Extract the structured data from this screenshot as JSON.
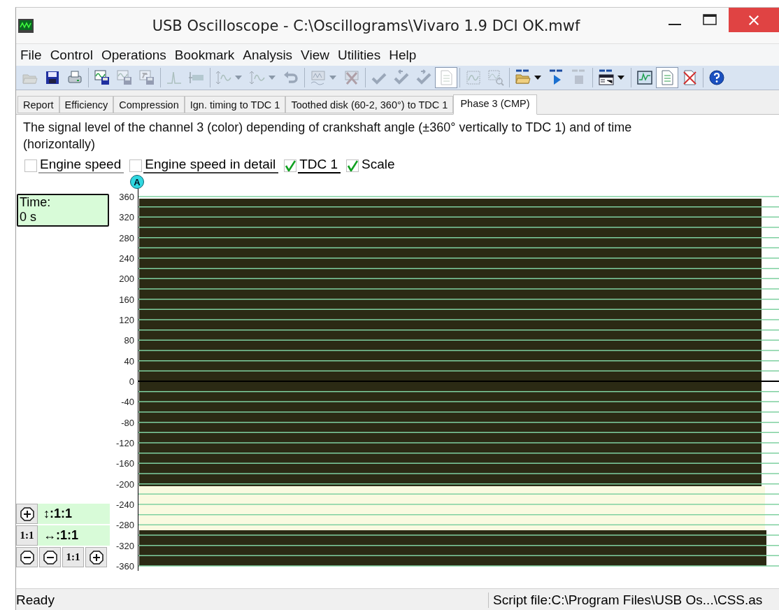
{
  "window": {
    "title": "USB Oscilloscope - C:\\Oscillograms\\Vivaro 1.9 DCI OK.mwf"
  },
  "menu": [
    "File",
    "Control",
    "Operations",
    "Bookmark",
    "Analysis",
    "View",
    "Utilities",
    "Help"
  ],
  "toolbar": [
    {
      "kind": "open",
      "disabled": true,
      "pressed": false,
      "dropdown": false
    },
    {
      "kind": "save",
      "disabled": false,
      "pressed": false,
      "dropdown": false
    },
    {
      "kind": "print",
      "disabled": false,
      "pressed": false,
      "dropdown": false
    },
    {
      "kind": "separator"
    },
    {
      "kind": "chart-save",
      "disabled": false,
      "pressed": false,
      "dropdown": false
    },
    {
      "kind": "chart-save",
      "disabled": true,
      "pressed": false,
      "dropdown": false
    },
    {
      "kind": "hammer-save",
      "disabled": true,
      "pressed": false,
      "dropdown": false
    },
    {
      "kind": "separator"
    },
    {
      "kind": "peak",
      "disabled": true,
      "pressed": false,
      "dropdown": false
    },
    {
      "kind": "measure",
      "disabled": true,
      "pressed": false,
      "dropdown": false
    },
    {
      "kind": "separator"
    },
    {
      "kind": "scale-wave",
      "disabled": true,
      "pressed": false,
      "dropdown": true
    },
    {
      "kind": "scale-wave",
      "disabled": true,
      "pressed": false,
      "dropdown": true
    },
    {
      "kind": "undo",
      "disabled": true,
      "pressed": false,
      "dropdown": false
    },
    {
      "kind": "separator"
    },
    {
      "kind": "monitor-wave",
      "disabled": true,
      "pressed": false,
      "dropdown": true
    },
    {
      "kind": "delete-wave",
      "disabled": true,
      "pressed": false,
      "dropdown": false
    },
    {
      "kind": "separator"
    },
    {
      "kind": "check",
      "disabled": true,
      "pressed": false,
      "dropdown": false
    },
    {
      "kind": "check-left",
      "disabled": true,
      "pressed": false,
      "dropdown": false
    },
    {
      "kind": "check-right",
      "disabled": true,
      "pressed": false,
      "dropdown": false
    },
    {
      "kind": "document",
      "disabled": true,
      "pressed": true,
      "dropdown": false
    },
    {
      "kind": "separator"
    },
    {
      "kind": "frame-wave",
      "disabled": true,
      "pressed": false,
      "dropdown": false
    },
    {
      "kind": "zoom-wave",
      "disabled": true,
      "pressed": false,
      "dropdown": false
    },
    {
      "kind": "separator"
    },
    {
      "kind": "script-open",
      "disabled": false,
      "pressed": false,
      "dropdown": true
    },
    {
      "kind": "script-run",
      "disabled": false,
      "pressed": false,
      "dropdown": false
    },
    {
      "kind": "script-stop",
      "disabled": true,
      "pressed": false,
      "dropdown": false
    },
    {
      "kind": "separator"
    },
    {
      "kind": "script-window",
      "disabled": false,
      "pressed": false,
      "dropdown": true
    },
    {
      "kind": "separator"
    },
    {
      "kind": "scope",
      "disabled": false,
      "pressed": false,
      "dropdown": false
    },
    {
      "kind": "document",
      "disabled": false,
      "pressed": true,
      "dropdown": false
    },
    {
      "kind": "delete-document",
      "disabled": false,
      "pressed": false,
      "dropdown": false
    },
    {
      "kind": "separator"
    },
    {
      "kind": "help",
      "disabled": false,
      "pressed": false,
      "dropdown": false
    }
  ],
  "tabs": [
    {
      "label": "Report",
      "selected": false
    },
    {
      "label": "Efficiency",
      "selected": false
    },
    {
      "label": "Compression",
      "selected": false
    },
    {
      "label": "Ign. timing to TDC 1",
      "selected": false
    },
    {
      "label": "Toothed disk (60-2, 360°) to TDC 1",
      "selected": false
    },
    {
      "label": "Phase 3 (CMP)",
      "selected": true
    }
  ],
  "description": "The signal level of the channel 3 (color) depending of crankshaft angle (±360° vertically to TDC 1) and of time (horizontally)",
  "options": [
    {
      "label": "Engine speed",
      "checked": false,
      "color": "#a8a8a8"
    },
    {
      "label": "Engine speed in detail",
      "checked": false,
      "color": "#404040"
    },
    {
      "label": "TDC 1",
      "checked": true,
      "color": "#000000"
    },
    {
      "label": "Scale",
      "checked": true
    }
  ],
  "time_box": {
    "label": "Time:",
    "value": "0 s"
  },
  "marker": "A",
  "y_ticks": [
    "360",
    "320",
    "280",
    "240",
    "200",
    "160",
    "120",
    "80",
    "40",
    "0",
    "-40",
    "-80",
    "-120",
    "-160",
    "-200",
    "-240",
    "-280",
    "-320",
    "-360"
  ],
  "zoom_panel": {
    "vertical_scale": "↕:1:1",
    "horizontal_scale": "↔:1:1",
    "buttons": [
      {
        "kind": "zoom-in"
      },
      {
        "kind": "reset",
        "label": "1:1"
      },
      {
        "kind": "zoom-out"
      },
      {
        "kind": "zoom-out"
      },
      {
        "kind": "reset",
        "label": "1:1"
      },
      {
        "kind": "zoom-in"
      }
    ]
  },
  "status_bar": {
    "left": "Ready",
    "right": "Script file:C:\\Program Files\\USB Os...\\CSS.as"
  }
}
